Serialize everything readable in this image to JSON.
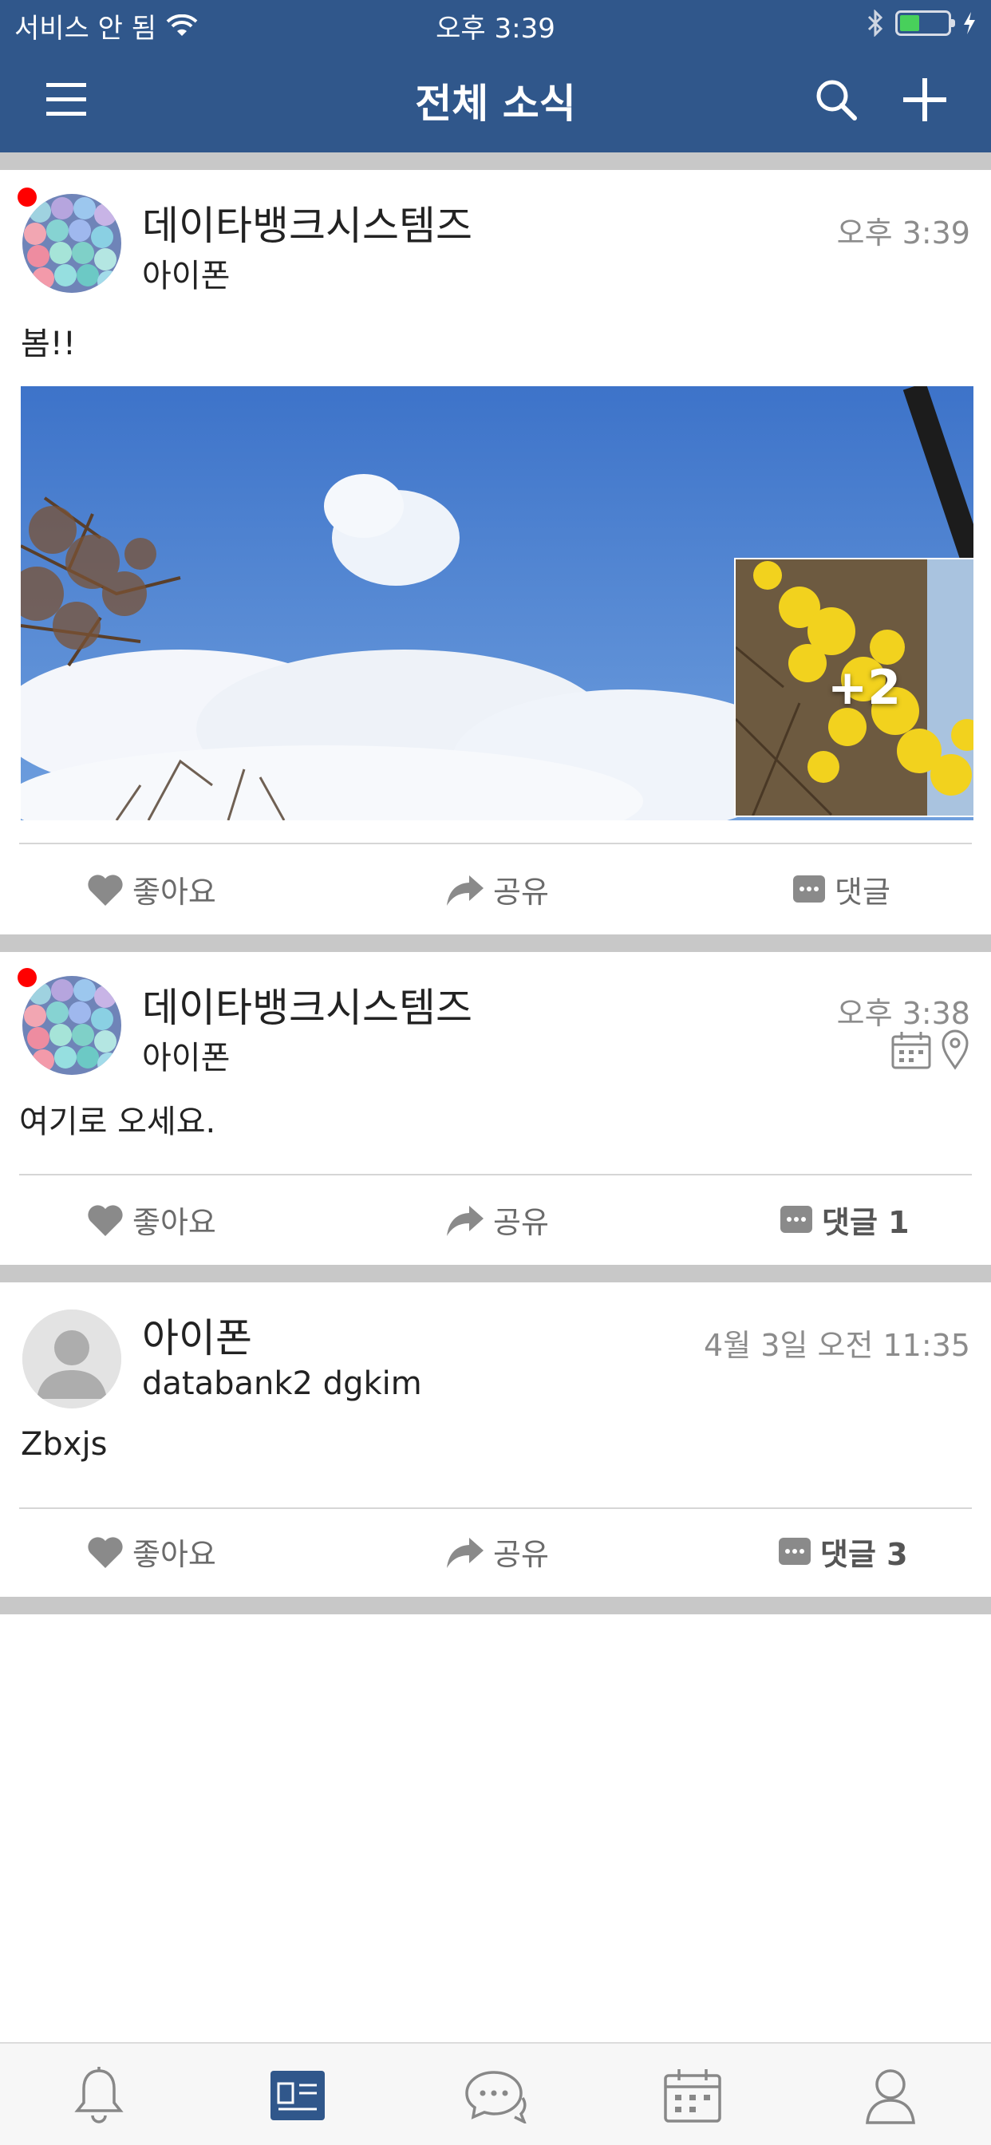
{
  "status_bar": {
    "carrier": "서비스 안 됨",
    "time": "오후 3:39"
  },
  "header": {
    "title": "전체 소식"
  },
  "posts": [
    {
      "author": "데이타뱅크시스템즈",
      "sub": "아이폰",
      "time": "오후 3:39",
      "body": "봄!!",
      "more_photos": "+2",
      "like_label": "좋아요",
      "share_label": "공유",
      "comment_label": "댓글"
    },
    {
      "author": "데이타뱅크시스템즈",
      "sub": "아이폰",
      "time": "오후 3:38",
      "body": "여기로 오세요.",
      "like_label": "좋아요",
      "share_label": "공유",
      "comment_label": "댓글 1"
    },
    {
      "author": "아이폰",
      "sub": "databank2 dgkim",
      "time": "4월 3일 오전 11:35",
      "body": "Zbxjs",
      "like_label": "좋아요",
      "share_label": "공유",
      "comment_label": "댓글 3"
    }
  ],
  "tabbar": {
    "items": [
      "bell-icon",
      "newsfeed-icon",
      "chat-icon",
      "calendar-icon",
      "profile-icon"
    ],
    "active": "newsfeed-icon"
  },
  "colors": {
    "brand": "#30578b",
    "separator": "#c8c8c8",
    "unread_dot": "#ff0000"
  }
}
